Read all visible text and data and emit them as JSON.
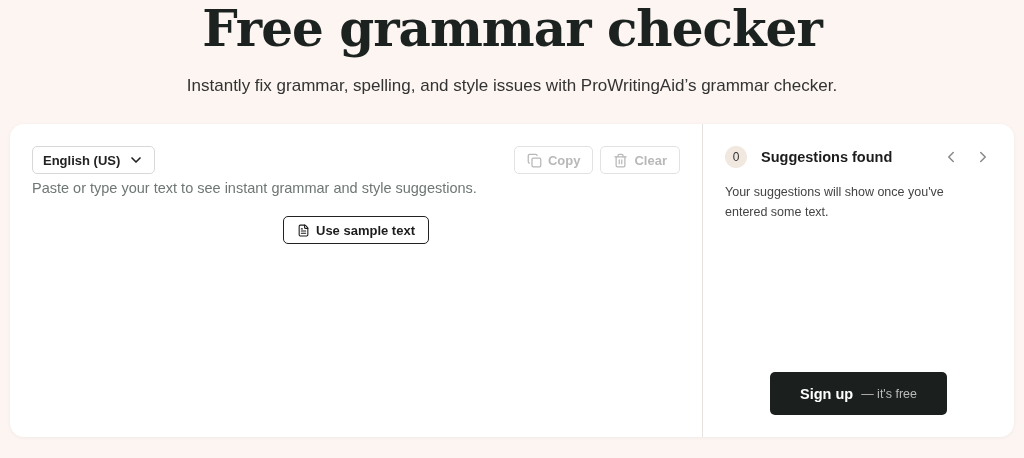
{
  "header": {
    "title": "Free grammar checker",
    "subtitle": "Instantly fix grammar, spelling, and style issues with ProWritingAid’s grammar checker."
  },
  "editor": {
    "language": "English (US)",
    "actions": [
      {
        "kind": "copy",
        "label": "Copy",
        "disabled": true
      },
      {
        "kind": "clear",
        "label": "Clear",
        "disabled": true
      }
    ],
    "placeholder": "Paste or type your text to see instant grammar and style suggestions.",
    "sample_button": "Use sample text"
  },
  "suggestions": {
    "count": "0",
    "title": "Suggestions found",
    "message": "Your suggestions will show once you've entered some text.",
    "signup": {
      "label": "Sign up",
      "note": "— it's free"
    }
  }
}
